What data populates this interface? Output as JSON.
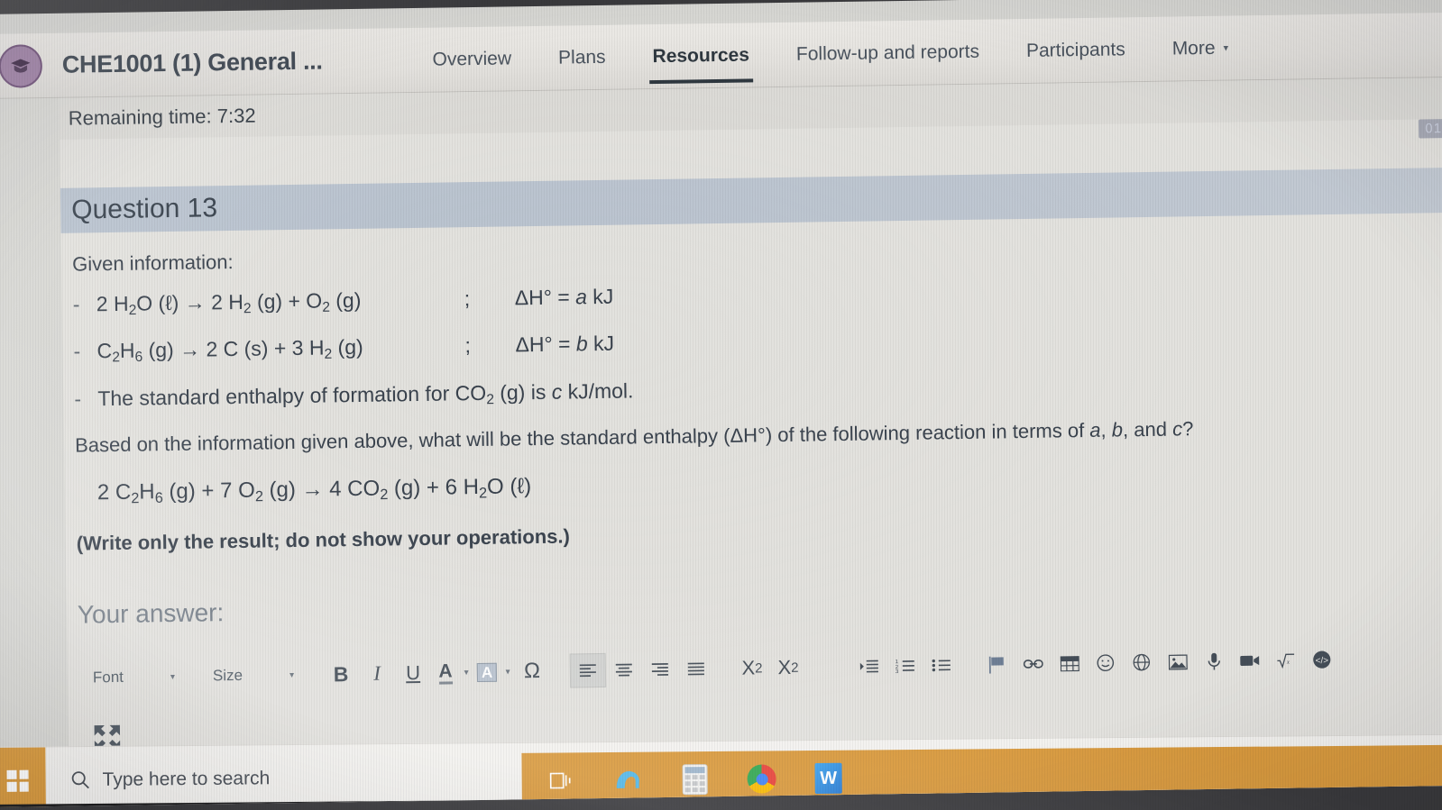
{
  "appbar": {
    "logo_icon": "graduation-cap-icon",
    "course_title": "CHE1001 (1) General ...",
    "tabs": [
      {
        "label": "Overview",
        "active": false
      },
      {
        "label": "Plans",
        "active": false
      },
      {
        "label": "Resources",
        "active": true
      },
      {
        "label": "Follow-up and reports",
        "active": false
      },
      {
        "label": "Participants",
        "active": false
      },
      {
        "label": "More",
        "active": false,
        "caret": "▾"
      }
    ]
  },
  "timebar": {
    "remaining_time_label": "Remaining time: 7:32"
  },
  "corner_badge": {
    "text": "01"
  },
  "question": {
    "header": "Question 13",
    "given_label": "Given information:",
    "equations": [
      {
        "dash": "-",
        "lhs_html": "2 H<sub>2</sub>O (ℓ) → 2 H<sub>2</sub> (g) + O<sub>2</sub> (g)",
        "semicolon": ";",
        "delta_html": "ΔH° = <span class=\"ital\">a</span> kJ"
      },
      {
        "dash": "-",
        "lhs_html": "C<sub>2</sub>H<sub>6</sub> (g) → 2 C (s) + 3 H<sub>2</sub> (g)",
        "semicolon": ";",
        "delta_html": "ΔH° = <span class=\"ital\">b</span> kJ"
      }
    ],
    "fact": {
      "dash": "-",
      "html": "The standard enthalpy of formation for CO<sub>2</sub> (g) is <span class=\"ital\">c</span> kJ/mol."
    },
    "prompt_html": "Based on the information given above, what will be the standard enthalpy (ΔH°) of the following reaction in terms of <span class=\"ital\">a</span>, <span class=\"ital\">b</span>, and <span class=\"ital\">c</span>?",
    "target_equation_html": "2 C<sub>2</sub>H<sub>6</sub> (g) + 7 O<sub>2</sub> (g) → 4 CO<sub>2</sub> (g) + 6 H<sub>2</sub>O (ℓ)",
    "note": "(Write only the result; do not show your operations.)",
    "your_answer_label": "Your answer:"
  },
  "editor_toolbar": {
    "font_label": "Font",
    "font_caret": "▾",
    "size_label": "Size",
    "size_caret": "▾",
    "bold_label": "B",
    "italic_label": "I",
    "underline_label": "U",
    "text_color_label": "A",
    "text_color_caret": "▾",
    "highlight_label": "A",
    "highlight_caret": "▾",
    "omega_label": "Ω",
    "subscript_label": "X",
    "subscript_sub": "2",
    "superscript_label": "X",
    "superscript_sup": "2",
    "icons": [
      "align-left-icon",
      "align-center-icon",
      "align-right-icon",
      "align-justify-icon",
      "subscript-icon",
      "superscript-icon",
      "indent-icon",
      "numbered-list-icon",
      "bulleted-list-icon",
      "flag-icon",
      "link-icon",
      "table-icon",
      "emoji-icon",
      "globe-icon",
      "image-icon",
      "microphone-icon",
      "video-icon",
      "square-root-icon",
      "code-icon"
    ],
    "expand_icon": "fullscreen-expand-icon"
  },
  "taskbar": {
    "start_icon": "windows-start-icon",
    "search_icon": "search-icon",
    "search_placeholder": "Type here to search",
    "apps": [
      {
        "icon": "task-view-icon",
        "label": ""
      },
      {
        "icon": "edge-browser-icon",
        "label": "e"
      },
      {
        "icon": "calculator-icon",
        "label": ""
      },
      {
        "icon": "chrome-browser-icon",
        "label": ""
      },
      {
        "icon": "word-app-icon",
        "label": "W"
      }
    ]
  },
  "colors": {
    "accent": "#2f3840",
    "question_band": "#bcc5d0",
    "taskbar_orange": "#d99a3e",
    "logo_purple": "#9d7fa4"
  }
}
